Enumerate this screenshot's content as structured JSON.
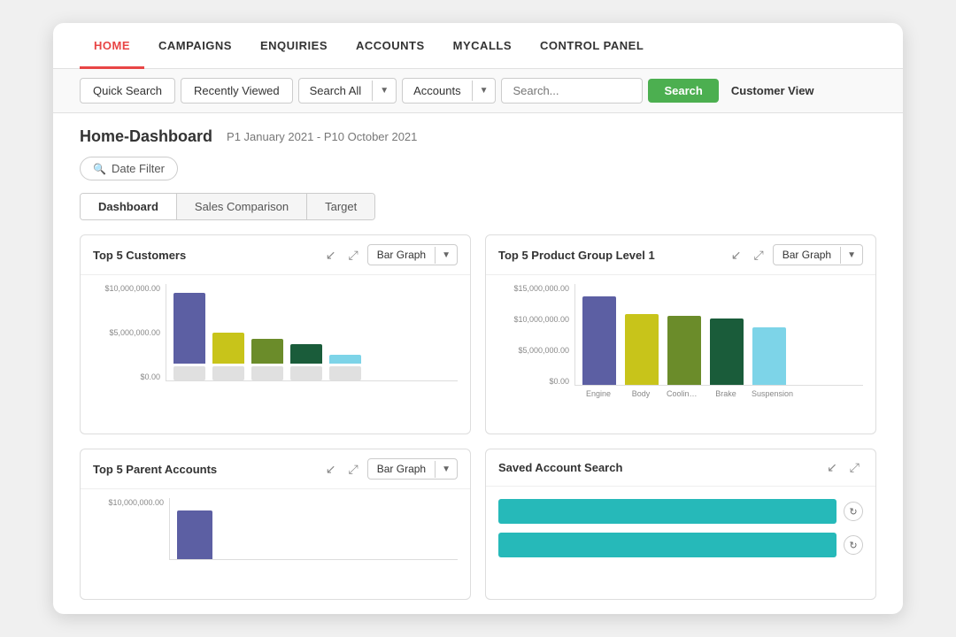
{
  "nav": {
    "items": [
      {
        "label": "HOME",
        "active": true
      },
      {
        "label": "CAMPAIGNS",
        "active": false
      },
      {
        "label": "ENQUIRIES",
        "active": false
      },
      {
        "label": "ACCOUNTS",
        "active": false
      },
      {
        "label": "MYCALLS",
        "active": false
      },
      {
        "label": "CONTROL PANEL",
        "active": false
      }
    ]
  },
  "searchBar": {
    "quickSearch": "Quick Search",
    "recentlyViewed": "Recently Viewed",
    "searchAll": "Search All",
    "accounts": "Accounts",
    "searchPlaceholder": "Search...",
    "searchBtn": "Search",
    "customerView": "Customer View"
  },
  "page": {
    "title": "Home-Dashboard",
    "dateRange": "P1 January 2021 - P10 October 2021",
    "dateFilter": "Date Filter"
  },
  "tabs": [
    {
      "label": "Dashboard",
      "active": true
    },
    {
      "label": "Sales Comparison",
      "active": false
    },
    {
      "label": "Target",
      "active": false
    }
  ],
  "charts": {
    "topCustomers": {
      "title": "Top 5 Customers",
      "type": "Bar Graph",
      "yLabels": [
        "$10,000,000.00",
        "$5,000,000.00",
        "$0.00"
      ],
      "bars": [
        {
          "color": "#5c5fa3",
          "height": 80
        },
        {
          "color": "#c8c41a",
          "height": 35
        },
        {
          "color": "#6b8c2a",
          "height": 28
        },
        {
          "color": "#1a5c3a",
          "height": 22
        },
        {
          "color": "#7dd4e8",
          "height": 10
        }
      ]
    },
    "topProductGroup": {
      "title": "Top 5 Product Group Level 1",
      "type": "Bar Graph",
      "yLabels": [
        "$15,000,000.00",
        "$10,000,000.00",
        "$5,000,000.00",
        "$0.00"
      ],
      "bars": [
        {
          "color": "#5c5fa3",
          "height": 100,
          "label": "Engine"
        },
        {
          "color": "#c8c41a",
          "height": 80,
          "label": "Body"
        },
        {
          "color": "#6b8c2a",
          "height": 78,
          "label": "Cooling an..."
        },
        {
          "color": "#1a5c3a",
          "height": 75,
          "label": "Brake"
        },
        {
          "color": "#7dd4e8",
          "height": 65,
          "label": "Suspension"
        }
      ]
    },
    "topParentAccounts": {
      "title": "Top 5 Parent Accounts",
      "type": "Bar Graph",
      "yLabels": [
        "$10,000,000.00"
      ],
      "bars": [
        {
          "color": "#5c5fa3",
          "height": 55
        }
      ]
    },
    "savedAccountSearch": {
      "title": "Saved Account Search",
      "items": [
        {
          "color": "#26b9b9"
        },
        {
          "color": "#26b9b9"
        }
      ]
    }
  },
  "icons": {
    "caret": "▼",
    "search": "🔍",
    "download": "↙",
    "expand": "⤢",
    "refresh": "↻"
  }
}
